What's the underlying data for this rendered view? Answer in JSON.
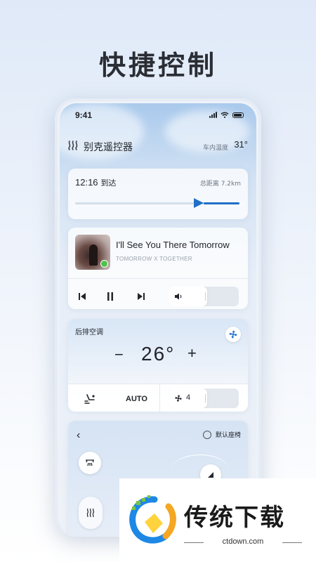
{
  "headline": "快捷控制",
  "status_bar": {
    "time": "9:41"
  },
  "app": {
    "title": "别克遥控器",
    "cabin_temp_label": "车内温度",
    "cabin_temp": "31°"
  },
  "navigation": {
    "arrival_time": "12:16",
    "arrival_label": "到达",
    "distance": "总距离 7.2km",
    "progress": 0.78
  },
  "music": {
    "song": "I'll See You There Tomorrow",
    "artist": "TOMORROW X TOGETHER",
    "volume": 0.55
  },
  "ac": {
    "label": "后排空调",
    "minus": "−",
    "temperature": "26°",
    "plus": "+",
    "mode": "AUTO",
    "fan_level": "4",
    "fan_fill": 0.55
  },
  "seat": {
    "back": "‹",
    "default_seat_label": "默认座椅"
  },
  "watermark": {
    "brand": "传统下载",
    "domain": "ctdown.com"
  }
}
